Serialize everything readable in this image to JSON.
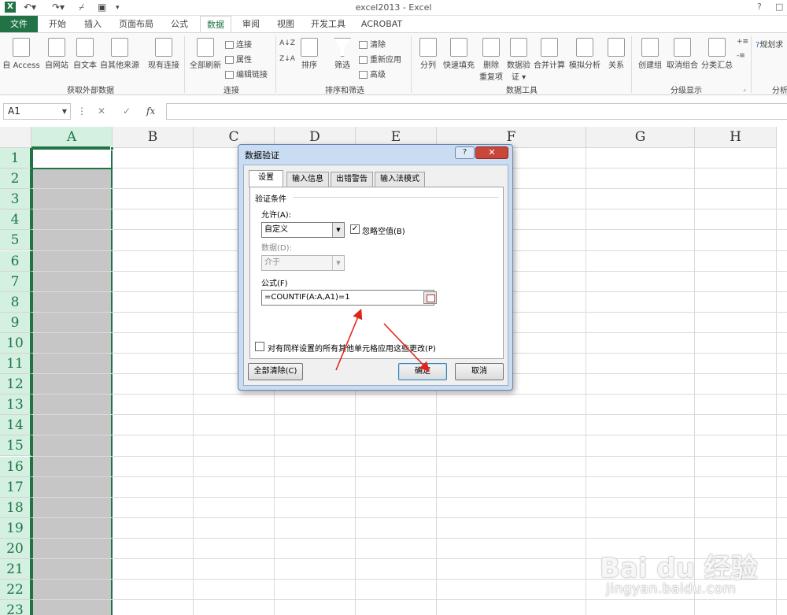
{
  "window": {
    "title": "excel2013 - Excel",
    "help_label": "?",
    "restore_label": "□"
  },
  "tabs": [
    "文件",
    "开始",
    "插入",
    "页面布局",
    "公式",
    "数据",
    "审阅",
    "视图",
    "开发工具",
    "ACROBAT"
  ],
  "ribbon": {
    "get_external": {
      "buttons": [
        "自 Access",
        "自网站",
        "自文本",
        "自其他来源",
        "现有连接"
      ],
      "label": "获取外部数据"
    },
    "connections": {
      "refresh_all": "全部刷新",
      "small": [
        "连接",
        "属性",
        "编辑链接"
      ],
      "label": "连接"
    },
    "sort_filter": {
      "sort": "排序",
      "filter": "筛选",
      "small": [
        "清除",
        "重新应用",
        "高级"
      ],
      "label": "排序和筛选"
    },
    "data_tools": {
      "buttons": [
        "分列",
        "快速填充",
        "删除\n重复项",
        "数据验\n证 ▾",
        "合并计算",
        "模拟分析",
        "关系"
      ],
      "label": "数据工具"
    },
    "outline": {
      "buttons": [
        "创建组",
        "取消组合",
        "分类汇总"
      ],
      "label": "分级显示"
    },
    "analysis": {
      "button": "规划求",
      "label": "分析"
    }
  },
  "formula_bar": {
    "name_box": "A1",
    "fx": "fx",
    "cancel": "✕",
    "enter": "✓",
    "more": "⋮",
    "value": ""
  },
  "grid": {
    "columns": [
      "A",
      "B",
      "C",
      "D",
      "E",
      "F",
      "G",
      "H"
    ],
    "rows": [
      "1",
      "2",
      "3",
      "4",
      "5",
      "6",
      "7",
      "8",
      "9",
      "10",
      "11",
      "12",
      "13",
      "14",
      "15",
      "16",
      "17",
      "18",
      "19",
      "20",
      "21",
      "22",
      "23"
    ]
  },
  "dialog": {
    "title": "数据验证",
    "tabs": [
      "设置",
      "输入信息",
      "出错警告",
      "输入法模式"
    ],
    "section": "验证条件",
    "allow_label": "允许(A):",
    "allow_value": "自定义",
    "ignore_blank": "忽略空值(B)",
    "ignore_blank_checked": true,
    "data_label": "数据(D):",
    "data_value": "介于",
    "formula_label": "公式(F)",
    "formula_value": "=COUNTIF(A:A,A1)=1",
    "apply_all": "对有同样设置的所有其他单元格应用这些更改(P)",
    "clear_all": "全部清除(C)",
    "ok": "确定",
    "cancel": "取消"
  },
  "watermark": {
    "main": "Bai du 经验",
    "sub": "jingyan.baidu.com"
  },
  "colors": {
    "excel_green": "#217346",
    "arrow_red": "#e0261a",
    "dialog_frame": "#c9dcf2"
  }
}
